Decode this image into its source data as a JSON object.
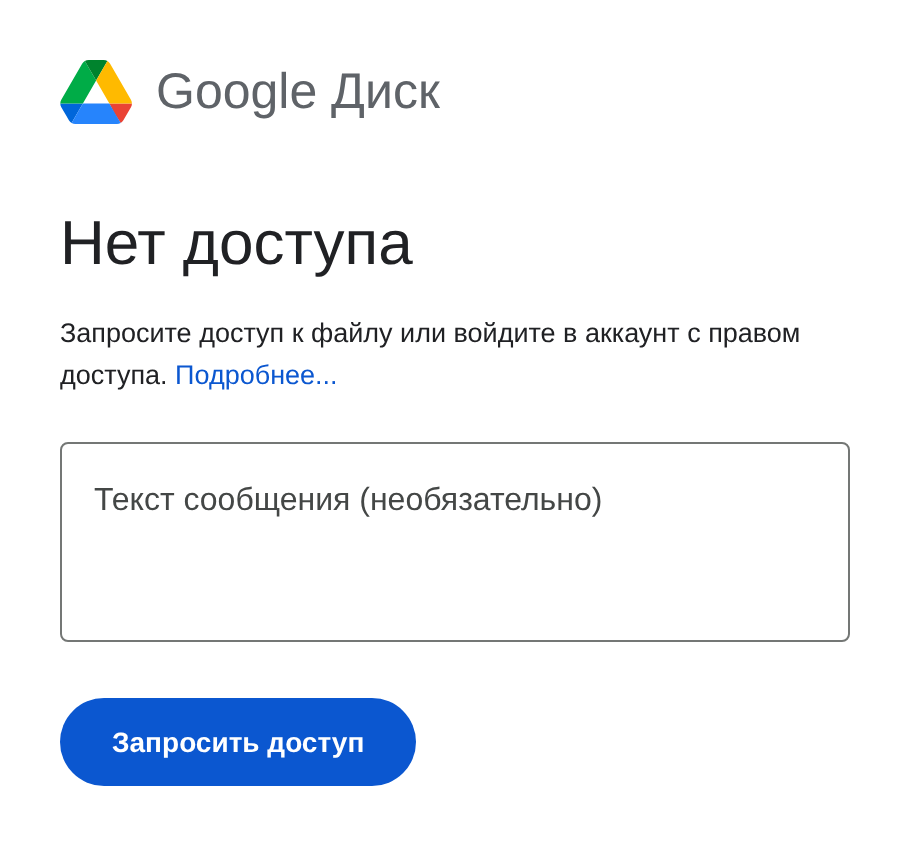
{
  "logo": {
    "brand": "Google",
    "product": "Диск"
  },
  "heading": "Нет доступа",
  "message": {
    "text": "Запросите доступ к файлу или войдите в аккаунт с правом доступа.",
    "link": "Подробнее..."
  },
  "textarea": {
    "placeholder": "Текст сообщения (необязательно)"
  },
  "button": "Запросить доступ"
}
